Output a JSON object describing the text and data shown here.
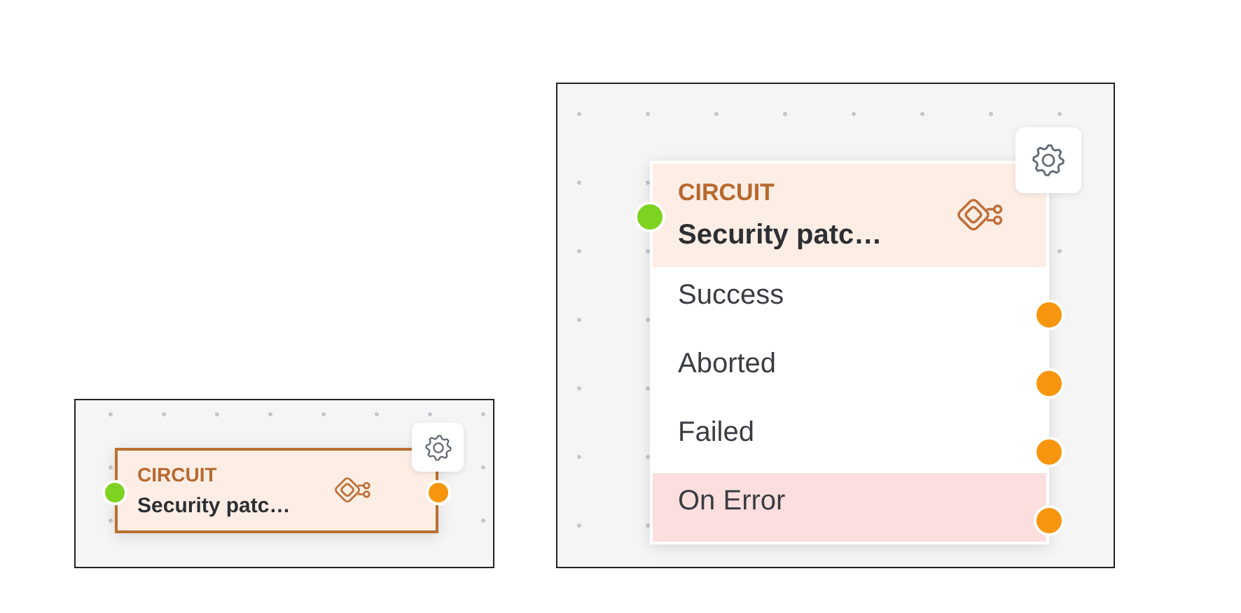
{
  "canvases": [
    {
      "node": {
        "category": "CIRCUIT",
        "title": "Security patc…",
        "selected": true
      }
    },
    {
      "node": {
        "category": "CIRCUIT",
        "title": "Security patc…",
        "selected": false,
        "outputs": [
          {
            "label": "Success",
            "kind": "normal"
          },
          {
            "label": "Aborted",
            "kind": "normal"
          },
          {
            "label": "Failed",
            "kind": "normal"
          },
          {
            "label": "On Error",
            "kind": "error"
          }
        ]
      }
    }
  ]
}
